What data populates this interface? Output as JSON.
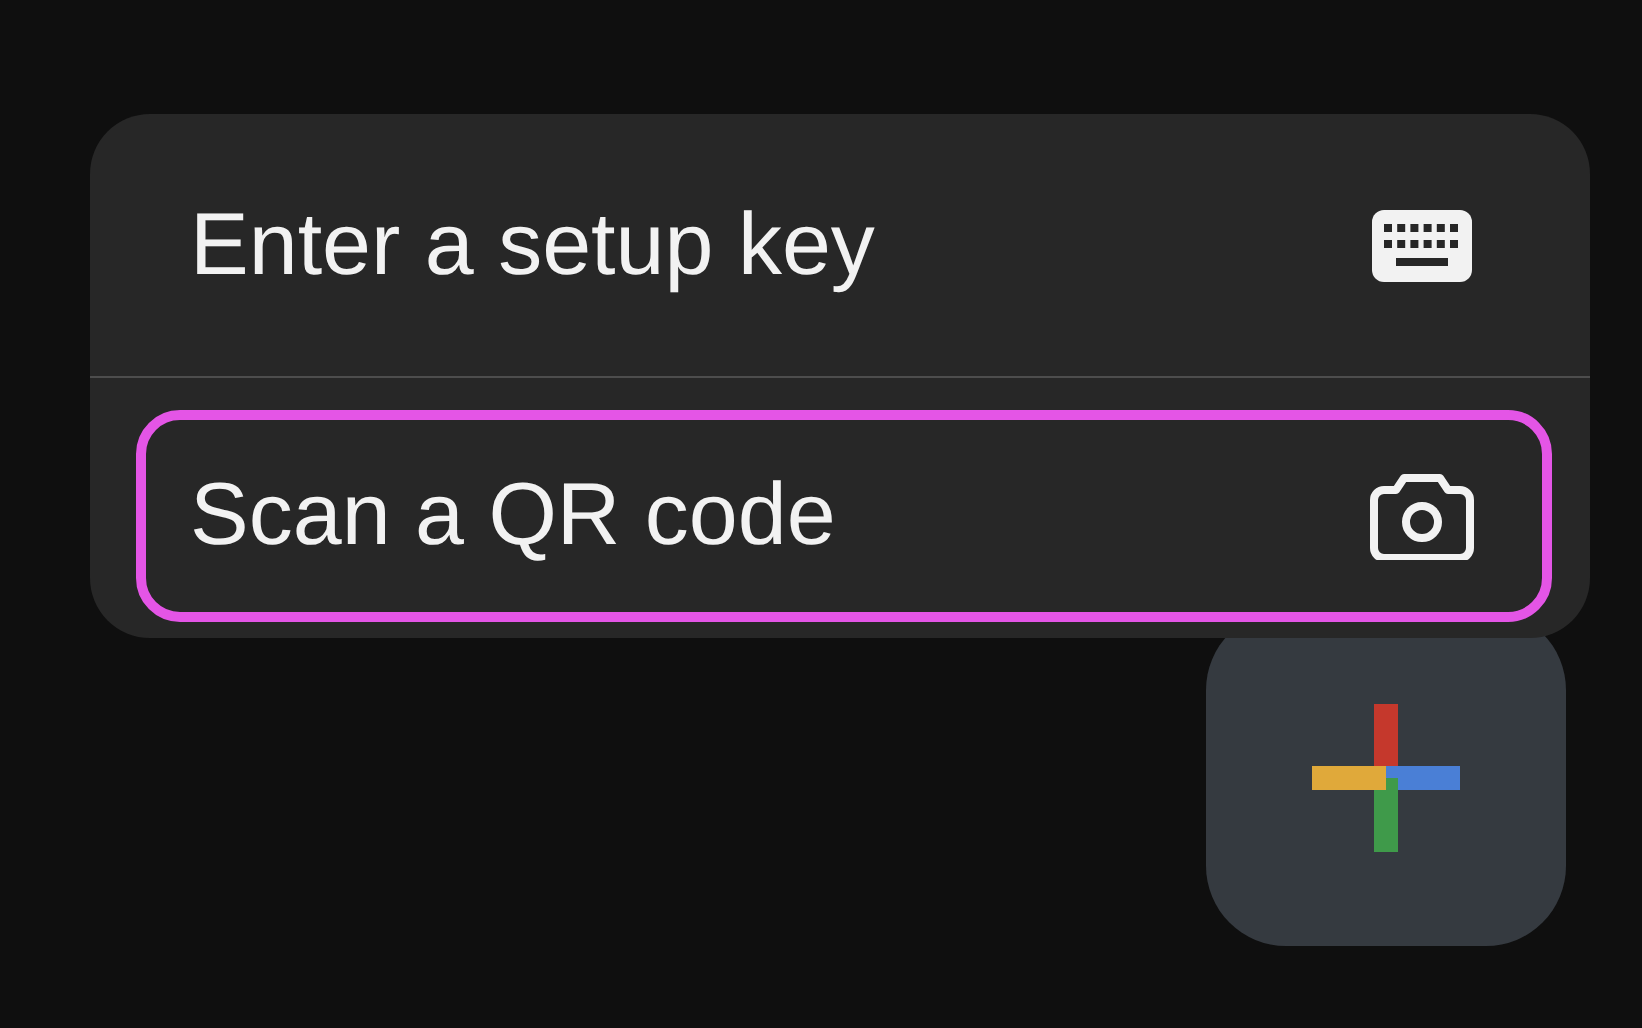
{
  "menu": {
    "items": [
      {
        "label": "Enter a setup key",
        "kind": "keyboard",
        "highlighted": false
      },
      {
        "label": "Scan a QR code",
        "kind": "camera",
        "highlighted": true
      }
    ]
  },
  "fab": {
    "kind": "add"
  }
}
